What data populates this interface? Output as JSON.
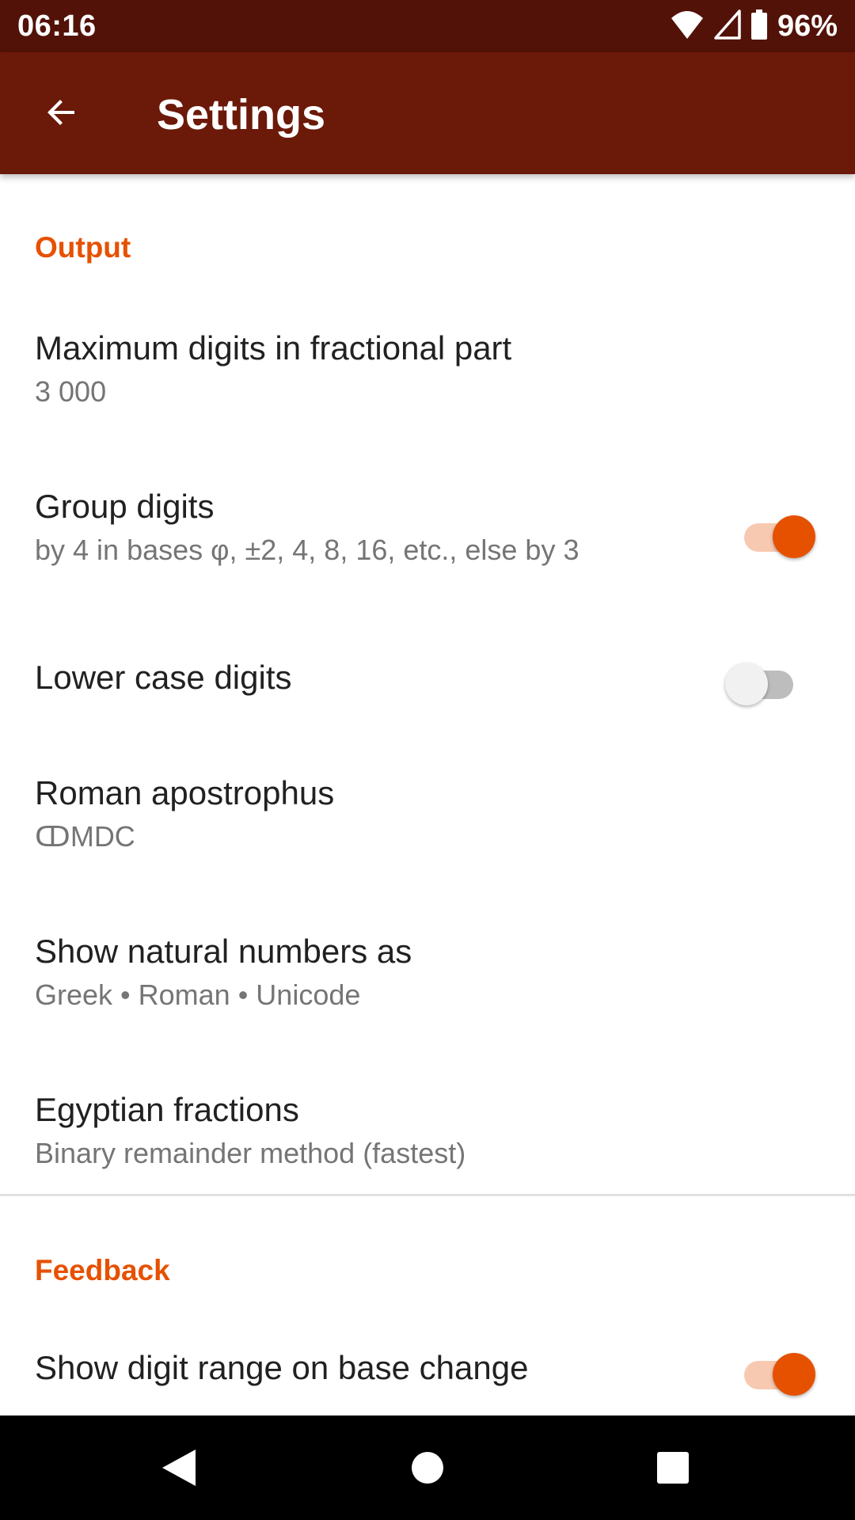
{
  "status_bar": {
    "time": "06:16",
    "battery_percent": "96%",
    "icons": [
      "wifi-icon",
      "cell-signal-icon",
      "battery-icon"
    ]
  },
  "app_bar": {
    "title": "Settings",
    "back_icon": "arrow-back-icon"
  },
  "sections": {
    "output": {
      "header": "Output",
      "max_digits": {
        "title": "Maximum digits in fractional part",
        "summary": "3 000"
      },
      "group_digits": {
        "title": "Group digits",
        "summary": "by 4 in bases φ, ±2, 4, 8, 16, etc., else by 3",
        "checked": true
      },
      "lower_case": {
        "title": "Lower case digits",
        "checked": false
      },
      "roman_apostrophus": {
        "title": "Roman apostrophus",
        "summary": "ↀMDC"
      },
      "natural_numbers": {
        "title": "Show natural numbers as",
        "summary": "Greek • Roman • Unicode"
      },
      "egyptian_fractions": {
        "title": "Egyptian fractions",
        "summary": "Binary remainder method (fastest)"
      }
    },
    "feedback": {
      "header": "Feedback",
      "digit_range": {
        "title": "Show digit range on base change",
        "checked": true
      }
    }
  },
  "colors": {
    "status_bar": "#521208",
    "app_bar": "#6b1909",
    "accent": "#e65100"
  },
  "nav_bar": {
    "icons": [
      "nav-back-icon",
      "nav-home-icon",
      "nav-recents-icon"
    ]
  }
}
